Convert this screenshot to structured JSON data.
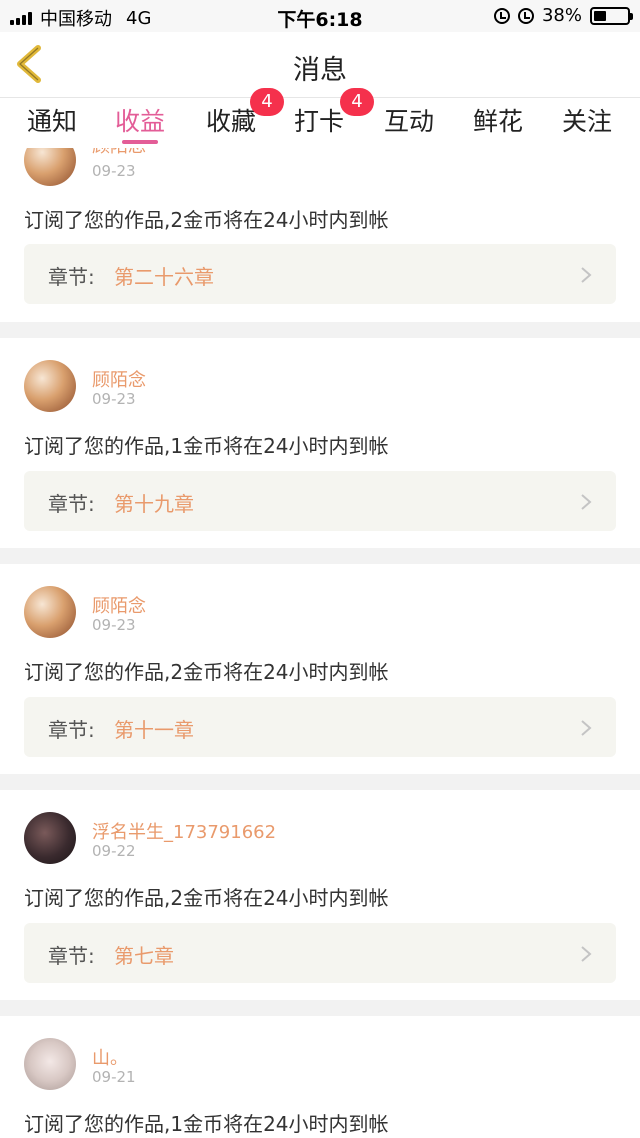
{
  "status_bar": {
    "carrier": "中国移动",
    "network": "4G",
    "time": "下午6:18",
    "battery": "38%",
    "battery_level": 0.38
  },
  "header": {
    "title": "消息",
    "back_icon": "chevron-left-icon"
  },
  "tabs": [
    {
      "label": "通知"
    },
    {
      "label": "收益",
      "active": true
    },
    {
      "label": "收藏",
      "badge": "4"
    },
    {
      "label": "打卡",
      "badge": "4"
    },
    {
      "label": "互动"
    },
    {
      "label": "鲜花"
    },
    {
      "label": "关注"
    }
  ],
  "messages": [
    {
      "user": "顾陌念",
      "date": "09-23",
      "text": "订阅了您的作品,2金币将在24小时内到帐",
      "chapter_label": "章节:",
      "chapter": "第二十六章"
    },
    {
      "user": "顾陌念",
      "date": "09-23",
      "text": "订阅了您的作品,1金币将在24小时内到帐",
      "chapter_label": "章节:",
      "chapter": "第十九章"
    },
    {
      "user": "顾陌念",
      "date": "09-23",
      "text": "订阅了您的作品,2金币将在24小时内到帐",
      "chapter_label": "章节:",
      "chapter": "第十一章"
    },
    {
      "user": "浮名半生_173791662",
      "date": "09-22",
      "text": "订阅了您的作品,2金币将在24小时内到帐",
      "chapter_label": "章节:",
      "chapter": "第七章"
    },
    {
      "user": "山。",
      "date": "09-21",
      "text": "订阅了您的作品,1金币将在24小时内到帐"
    }
  ],
  "colors": {
    "accent": "#e35d97",
    "username": "#e99a6c",
    "badge": "#f5314c",
    "back_arrow": "#e0b83a"
  }
}
